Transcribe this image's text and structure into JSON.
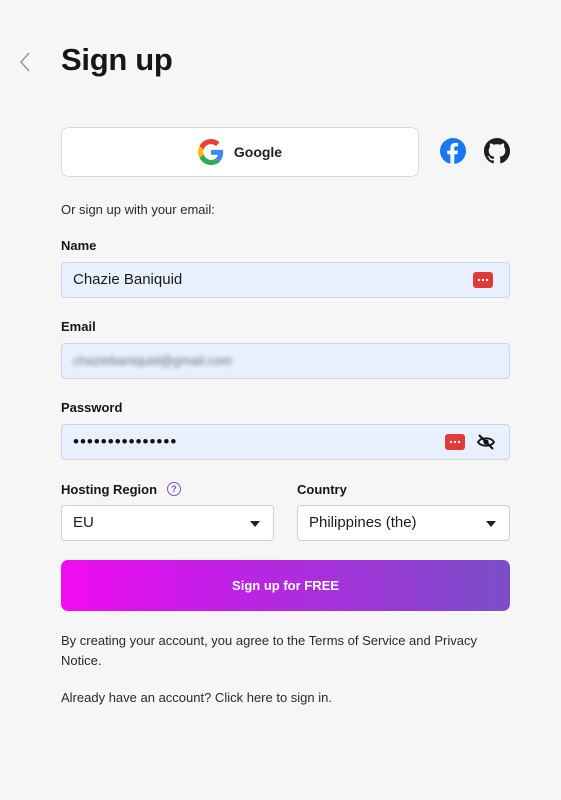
{
  "header": {
    "title": "Sign up",
    "back_icon": "chevron-left-icon"
  },
  "social": {
    "google_label": "Google",
    "icons": [
      "google-icon",
      "facebook-icon",
      "github-icon"
    ]
  },
  "or_text": "Or sign up with your email:",
  "form": {
    "name": {
      "label": "Name",
      "value": "Chazie Baniquid"
    },
    "email": {
      "label": "Email",
      "value": "chaziebaniquid@gmail.com"
    },
    "password": {
      "label": "Password",
      "value": "•••••••••••••••"
    },
    "hosting_region": {
      "label": "Hosting Region",
      "help": "?",
      "value": "EU"
    },
    "country": {
      "label": "Country",
      "value": "Philippines (the)"
    },
    "submit_label": "Sign up for FREE"
  },
  "footer": {
    "terms": "By creating your account, you agree to the Terms of Service and Privacy Notice.",
    "signin": "Already have an account? Click here to sign in."
  },
  "colors": {
    "background": "#f6f6f6",
    "field_fill": "#e8effd",
    "gradient_start": "#f20bf1",
    "gradient_end": "#7a4fc8",
    "password_manager": "#e03a3a",
    "facebook": "#1877f2"
  }
}
